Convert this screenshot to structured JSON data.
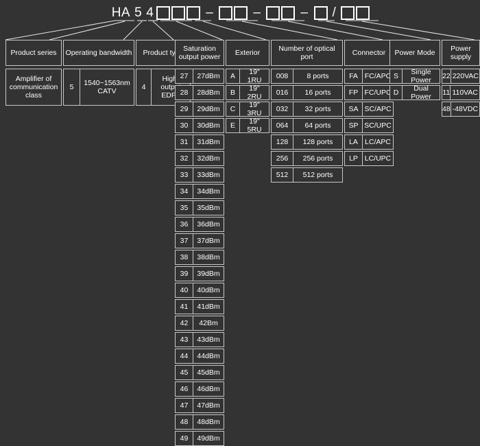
{
  "code_string": {
    "tokens": [
      {
        "type": "text",
        "value": "HA"
      },
      {
        "type": "text",
        "value": "5"
      },
      {
        "type": "text",
        "value": "4"
      },
      {
        "type": "box",
        "value": ""
      },
      {
        "type": "box",
        "value": ""
      },
      {
        "type": "box",
        "value": ""
      },
      {
        "type": "dash",
        "value": "–"
      },
      {
        "type": "box",
        "value": ""
      },
      {
        "type": "box",
        "value": ""
      },
      {
        "type": "dash",
        "value": "–"
      },
      {
        "type": "box",
        "value": ""
      },
      {
        "type": "box",
        "value": ""
      },
      {
        "type": "dash",
        "value": "–"
      },
      {
        "type": "box",
        "value": ""
      },
      {
        "type": "slash",
        "value": "/"
      },
      {
        "type": "box",
        "value": ""
      },
      {
        "type": "box",
        "value": ""
      }
    ]
  },
  "colors": {
    "background": "#333333",
    "border": "#c8c8c8",
    "text": "#ffffff"
  },
  "columns": [
    {
      "id": "product-series",
      "header": "Product series",
      "rows": [
        {
          "code": "",
          "desc": "Amplifier of communication class"
        }
      ]
    },
    {
      "id": "operating-bandwidth",
      "header": "Operating bandwidth",
      "rows": [
        {
          "code": "5",
          "desc": "1540~1563nm CATV"
        }
      ]
    },
    {
      "id": "product-type",
      "header": "Product type",
      "rows": [
        {
          "code": "4",
          "desc": "High-output EDFA"
        }
      ]
    },
    {
      "id": "saturation-output-power",
      "header": "Saturation output power",
      "rows": [
        {
          "code": "27",
          "desc": "27dBm"
        },
        {
          "code": "28",
          "desc": "28dBm"
        },
        {
          "code": "29",
          "desc": "29dBm"
        },
        {
          "code": "30",
          "desc": "30dBm"
        },
        {
          "code": "31",
          "desc": "31dBm"
        },
        {
          "code": "32",
          "desc": "32dBm"
        },
        {
          "code": "33",
          "desc": "33dBm"
        },
        {
          "code": "34",
          "desc": "34dBm"
        },
        {
          "code": "35",
          "desc": "35dBm"
        },
        {
          "code": "36",
          "desc": "36dBm"
        },
        {
          "code": "37",
          "desc": "37dBm"
        },
        {
          "code": "38",
          "desc": "38dBm"
        },
        {
          "code": "39",
          "desc": "39dBm"
        },
        {
          "code": "40",
          "desc": "40dBm"
        },
        {
          "code": "41",
          "desc": "41dBm"
        },
        {
          "code": "42",
          "desc": "42Bm"
        },
        {
          "code": "43",
          "desc": "43dBm"
        },
        {
          "code": "44",
          "desc": "44dBm"
        },
        {
          "code": "45",
          "desc": "45dBm"
        },
        {
          "code": "46",
          "desc": "46dBm"
        },
        {
          "code": "47",
          "desc": "47dBm"
        },
        {
          "code": "48",
          "desc": "48dBm"
        },
        {
          "code": "49",
          "desc": "49dBm"
        }
      ]
    },
    {
      "id": "exterior",
      "header": "Exterior",
      "rows": [
        {
          "code": "A",
          "desc": "19\" 1RU"
        },
        {
          "code": "B",
          "desc": "19\" 2RU"
        },
        {
          "code": "C",
          "desc": "19\" 3RU"
        },
        {
          "code": "E",
          "desc": "19\" 5RU"
        }
      ]
    },
    {
      "id": "number-of-optical-port",
      "header": "Number of optical port",
      "rows": [
        {
          "code": "008",
          "desc": "8 ports"
        },
        {
          "code": "016",
          "desc": "16 ports"
        },
        {
          "code": "032",
          "desc": "32 ports"
        },
        {
          "code": "064",
          "desc": "64 ports"
        },
        {
          "code": "128",
          "desc": "128 ports"
        },
        {
          "code": "256",
          "desc": "256 ports"
        },
        {
          "code": "512",
          "desc": "512 ports"
        }
      ]
    },
    {
      "id": "connector",
      "header": "Connector",
      "rows": [
        {
          "code": "FA",
          "desc": "FC/APC"
        },
        {
          "code": "FP",
          "desc": "FC/UPC"
        },
        {
          "code": "SA",
          "desc": "SC/APC"
        },
        {
          "code": "SP",
          "desc": "SC/UPC"
        },
        {
          "code": "LA",
          "desc": "LC/APC"
        },
        {
          "code": "LP",
          "desc": "LC/UPC"
        }
      ]
    },
    {
      "id": "power-mode",
      "header": "Power Mode",
      "rows": [
        {
          "code": "S",
          "desc": "Single Power"
        },
        {
          "code": "D",
          "desc": "Dual Power"
        }
      ]
    },
    {
      "id": "power-supply",
      "header": "Power supply",
      "rows": [
        {
          "code": "22",
          "desc": "220VAC"
        },
        {
          "code": "11",
          "desc": "110VAC"
        },
        {
          "code": "48",
          "desc": "-48VDC"
        }
      ]
    }
  ]
}
